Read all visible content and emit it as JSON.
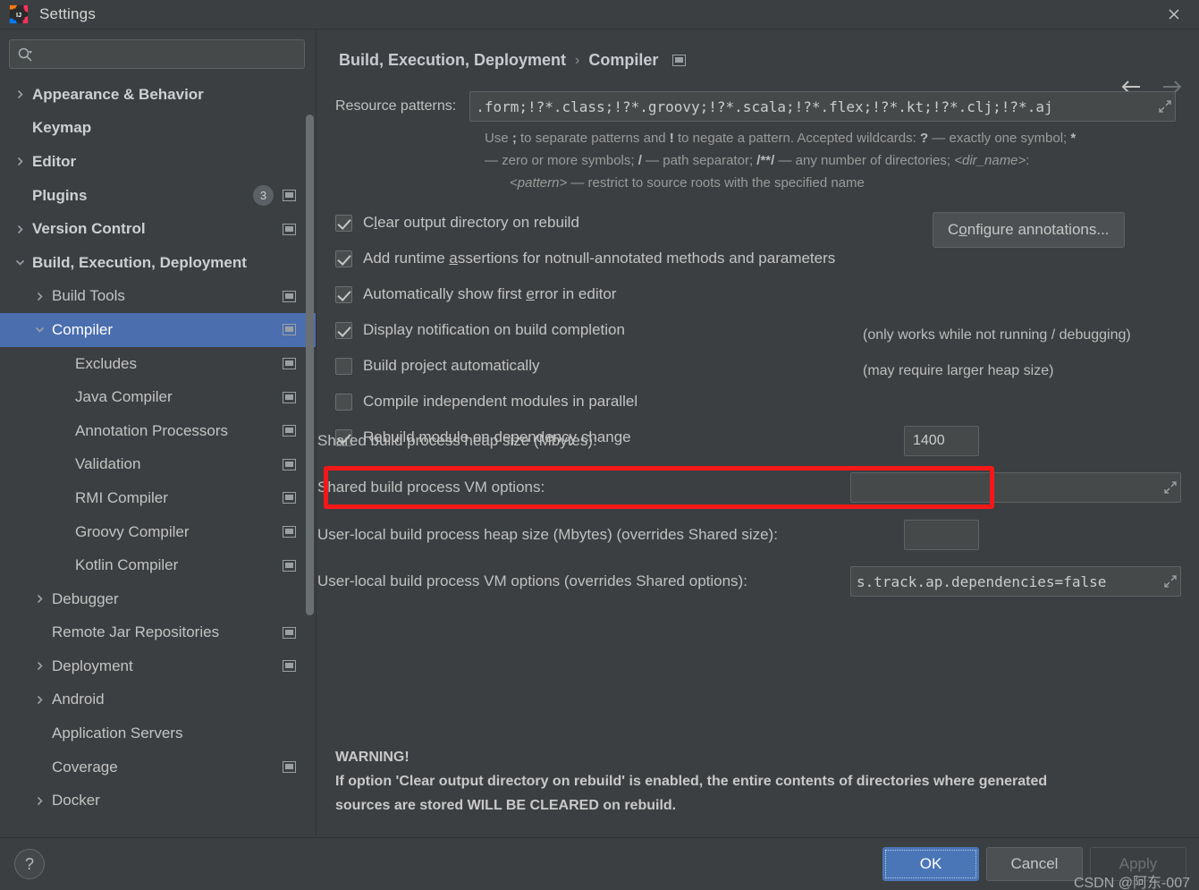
{
  "window": {
    "title": "Settings",
    "app_icon": "intellij-idea-logo",
    "close_icon": "close-icon"
  },
  "search": {
    "icon": "search-icon",
    "value": "",
    "placeholder": ""
  },
  "sidebar": {
    "items": [
      {
        "label": "Appearance & Behavior",
        "level": 0,
        "bold": true,
        "twisty": "collapsed",
        "badge": null,
        "scope_icon": false,
        "selected": false
      },
      {
        "label": "Keymap",
        "level": 0,
        "bold": true,
        "twisty": "none",
        "badge": null,
        "scope_icon": false,
        "selected": false
      },
      {
        "label": "Editor",
        "level": 0,
        "bold": true,
        "twisty": "collapsed",
        "badge": null,
        "scope_icon": false,
        "selected": false
      },
      {
        "label": "Plugins",
        "level": 0,
        "bold": true,
        "twisty": "none",
        "badge": "3",
        "scope_icon": true,
        "selected": false
      },
      {
        "label": "Version Control",
        "level": 0,
        "bold": true,
        "twisty": "collapsed",
        "badge": null,
        "scope_icon": true,
        "selected": false
      },
      {
        "label": "Build, Execution, Deployment",
        "level": 0,
        "bold": true,
        "twisty": "expanded",
        "badge": null,
        "scope_icon": false,
        "selected": false
      },
      {
        "label": "Build Tools",
        "level": 1,
        "bold": false,
        "twisty": "collapsed",
        "badge": null,
        "scope_icon": true,
        "selected": false
      },
      {
        "label": "Compiler",
        "level": 1,
        "bold": false,
        "twisty": "expanded",
        "badge": null,
        "scope_icon": true,
        "selected": true
      },
      {
        "label": "Excludes",
        "level": 2,
        "bold": false,
        "twisty": "none",
        "badge": null,
        "scope_icon": true,
        "selected": false
      },
      {
        "label": "Java Compiler",
        "level": 2,
        "bold": false,
        "twisty": "none",
        "badge": null,
        "scope_icon": true,
        "selected": false
      },
      {
        "label": "Annotation Processors",
        "level": 2,
        "bold": false,
        "twisty": "none",
        "badge": null,
        "scope_icon": true,
        "selected": false
      },
      {
        "label": "Validation",
        "level": 2,
        "bold": false,
        "twisty": "none",
        "badge": null,
        "scope_icon": true,
        "selected": false
      },
      {
        "label": "RMI Compiler",
        "level": 2,
        "bold": false,
        "twisty": "none",
        "badge": null,
        "scope_icon": true,
        "selected": false
      },
      {
        "label": "Groovy Compiler",
        "level": 2,
        "bold": false,
        "twisty": "none",
        "badge": null,
        "scope_icon": true,
        "selected": false
      },
      {
        "label": "Kotlin Compiler",
        "level": 2,
        "bold": false,
        "twisty": "none",
        "badge": null,
        "scope_icon": true,
        "selected": false
      },
      {
        "label": "Debugger",
        "level": 1,
        "bold": false,
        "twisty": "collapsed",
        "badge": null,
        "scope_icon": false,
        "selected": false
      },
      {
        "label": "Remote Jar Repositories",
        "level": 1,
        "bold": false,
        "twisty": "none",
        "badge": null,
        "scope_icon": true,
        "selected": false
      },
      {
        "label": "Deployment",
        "level": 1,
        "bold": false,
        "twisty": "collapsed",
        "badge": null,
        "scope_icon": true,
        "selected": false
      },
      {
        "label": "Android",
        "level": 1,
        "bold": false,
        "twisty": "collapsed",
        "badge": null,
        "scope_icon": false,
        "selected": false
      },
      {
        "label": "Application Servers",
        "level": 1,
        "bold": false,
        "twisty": "none",
        "badge": null,
        "scope_icon": false,
        "selected": false
      },
      {
        "label": "Coverage",
        "level": 1,
        "bold": false,
        "twisty": "none",
        "badge": null,
        "scope_icon": true,
        "selected": false
      },
      {
        "label": "Docker",
        "level": 1,
        "bold": false,
        "twisty": "collapsed",
        "badge": null,
        "scope_icon": false,
        "selected": false
      }
    ]
  },
  "header": {
    "breadcrumb_root": "Build, Execution, Deployment",
    "breadcrumb_sep": "›",
    "breadcrumb_leaf": "Compiler",
    "scope_icon": "project-scope-icon",
    "back_icon": "arrow-left-icon",
    "forward_icon": "arrow-right-icon"
  },
  "main": {
    "resource_patterns": {
      "label": "Resource patterns:",
      "value": ".form;!?*.class;!?*.groovy;!?*.scala;!?*.flex;!?*.kt;!?*.clj;!?*.aj",
      "expand_icon": "expand-icon"
    },
    "resource_hint_line1_a": "Use ",
    "resource_hint_line1_semicolon": ";",
    "resource_hint_line1_b": " to separate patterns and ",
    "resource_hint_line1_bang": "!",
    "resource_hint_line1_c": " to negate a pattern. Accepted wildcards: ",
    "resource_hint_line1_q": "?",
    "resource_hint_line1_d": " — exactly one symbol; ",
    "resource_hint_line1_star": "*",
    "resource_hint_line2_a": " — zero or more symbols; ",
    "resource_hint_line2_slash": "/",
    "resource_hint_line2_b": " — path separator; ",
    "resource_hint_line2_globstar": "/**/",
    "resource_hint_line2_c": " — any number of directories; ",
    "resource_hint_line2_dirname": "<dir_name>",
    "resource_hint_line2_colon": ":",
    "resource_hint_line3_pattern": "<pattern>",
    "resource_hint_line3_b": " — restrict to source roots with the specified name",
    "checkboxes": [
      {
        "label_pre": "C",
        "mnemonic": "l",
        "label_post": "ear output directory on rebuild",
        "checked": true
      },
      {
        "label_pre": "Add runtime ",
        "mnemonic": "a",
        "label_post": "ssertions for notnull-annotated methods and parameters",
        "checked": true
      },
      {
        "label_pre": "Automatically show first ",
        "mnemonic": "e",
        "label_post": "rror in editor",
        "checked": true
      },
      {
        "label_pre": "Display notification on build completion",
        "mnemonic": "",
        "label_post": "",
        "checked": true
      },
      {
        "label_pre": "Build project automatically",
        "mnemonic": "",
        "label_post": "",
        "checked": false
      },
      {
        "label_pre": "Compile independent modules in parallel",
        "mnemonic": "",
        "label_post": "",
        "checked": false
      },
      {
        "label_pre": "Rebuild module on dependency change",
        "mnemonic": "",
        "label_post": "",
        "checked": true
      }
    ],
    "configure_annotations": {
      "pre": "C",
      "mnemonic": "o",
      "post": "nfigure annotations..."
    },
    "note_build_auto": "(only works while not running / debugging)",
    "note_parallel": "(may require larger heap size)",
    "shared_heap": {
      "label": "Shared build process heap size (Mbytes):",
      "value": "1400"
    },
    "shared_vm": {
      "label": "Shared build process VM options:",
      "value": "",
      "expand_icon": "expand-icon"
    },
    "local_heap": {
      "label": "User-local build process heap size (Mbytes) (overrides Shared size):",
      "value": ""
    },
    "local_vm": {
      "label": "User-local build process VM options (overrides Shared options):",
      "value": "s.track.ap.dependencies=false",
      "expand_icon": "expand-icon"
    },
    "warning_title": "WARNING!",
    "warning_line1": "If option 'Clear output directory on rebuild' is enabled, the entire contents of directories where generated",
    "warning_line2": "sources are stored WILL BE CLEARED on rebuild.",
    "highlight_color": "#f41818"
  },
  "footer": {
    "help_label": "?",
    "ok_label": "OK",
    "cancel_label": "Cancel",
    "apply_label": "Apply"
  },
  "watermark": "CSDN @阿东-007"
}
